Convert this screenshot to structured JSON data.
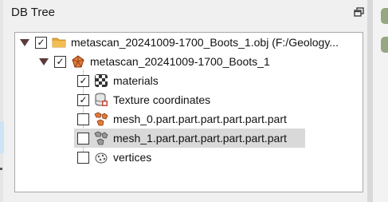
{
  "panel": {
    "title": "DB Tree"
  },
  "tree": {
    "items": [
      {
        "label": "metascan_20241009-1700_Boots_1.obj (F:/Geology...",
        "checked": true,
        "icon": "folder-icon"
      },
      {
        "label": "metascan_20241009-1700_Boots_1",
        "checked": true,
        "icon": "mesh-icon"
      },
      {
        "label": "materials",
        "checked": true,
        "icon": "materials-icon"
      },
      {
        "label": "Texture coordinates",
        "checked": true,
        "icon": "texture-coordinates-icon"
      },
      {
        "label": "mesh_0.part.part.part.part.part.part",
        "checked": false,
        "icon": "sub-mesh-icon"
      },
      {
        "label": "mesh_1.part.part.part.part.part.part",
        "checked": false,
        "icon": "sub-mesh-icon"
      },
      {
        "label": "vertices",
        "checked": false,
        "icon": "vertices-icon"
      }
    ]
  },
  "colors": {
    "selected_row": "#d9d9d9",
    "folder": "#e8a735",
    "mesh": "#e07b3c"
  }
}
